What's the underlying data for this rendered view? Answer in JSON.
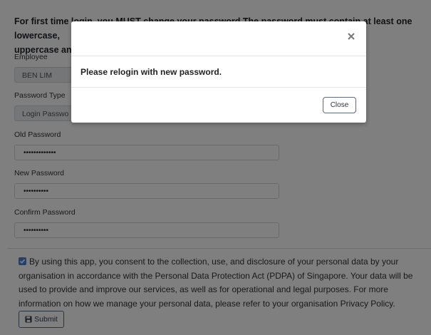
{
  "notice": {
    "line1": "For first time login, you MUST change your password.The password must contain at least one lowercase,",
    "line2": "uppercase and"
  },
  "form": {
    "employee": {
      "label": "Employee",
      "value": "BEN LIM"
    },
    "password_type": {
      "label": "Password Type",
      "value": "Login Passwo"
    },
    "old_password": {
      "label": "Old Password",
      "value": "•••••••••••••"
    },
    "new_password": {
      "label": "New Password",
      "value": "••••••••••"
    },
    "confirm_password": {
      "label": "Confirm Password",
      "value": "••••••••••"
    }
  },
  "consent": {
    "checked": true,
    "text": "By using this app, you consent to the collection, use, and disclosure of your personal data by your organisation in accordance with the Personal Data Protection Act (PDPA) of Singapore. Your data will be used to provide and improve our services, as well as for operational and legal purposes. For more information on how we manage your personal data, please refer to your organisation Privacy Policy."
  },
  "submit": {
    "label": "Submit",
    "icon": "save-icon"
  },
  "modal": {
    "message": "Please relogin with new password.",
    "close_label": "Close",
    "close_icon": "close-icon"
  },
  "colors": {
    "overlay": "rgba(0,0,0,0.5)",
    "checkbox": "#4a7fd1",
    "button_border": "#5a6b84"
  }
}
